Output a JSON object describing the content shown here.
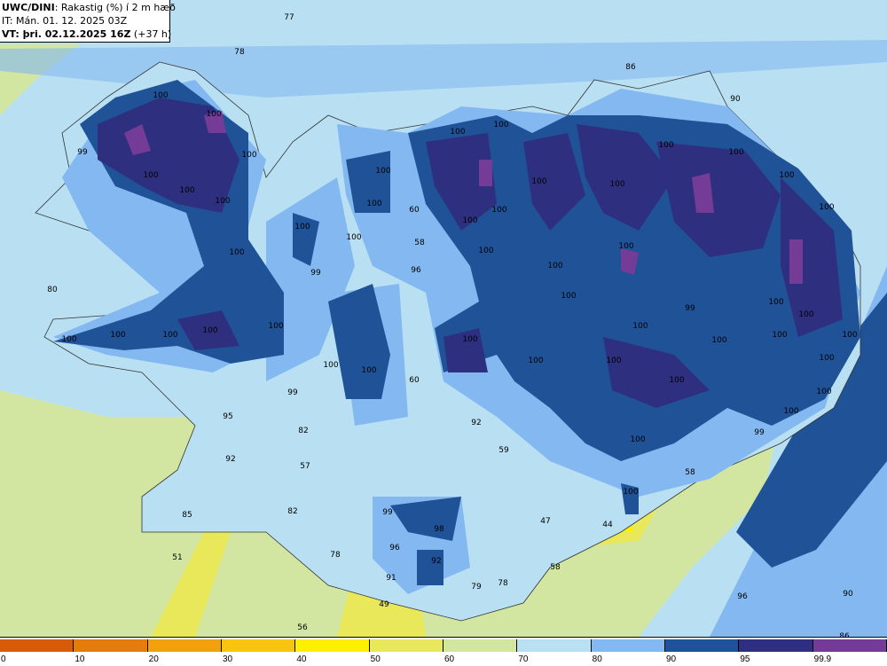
{
  "title": {
    "model": "UWC/DINI",
    "variable": ": Rakastig (%) í 2 m hæð",
    "issue_time": "IT: Mán. 01. 12. 2025 03Z",
    "valid_label": "VT: þri. 02.12.2025 16Z",
    "lead": " (+37 h)"
  },
  "legend": {
    "ticks": [
      "0",
      "10",
      "20",
      "30",
      "40",
      "50",
      "60",
      "70",
      "80",
      "90",
      "95",
      "99.9"
    ],
    "colors": [
      "#d65c0c",
      "#e27c0a",
      "#efa20a",
      "#f5c60c",
      "#fff000",
      "#e8e85a",
      "#d2e6a2",
      "#b9e0f2",
      "#84b8f0",
      "#1f5296",
      "#2f2f80",
      "#743c96"
    ]
  },
  "map_labels": [
    "77",
    "78",
    "86",
    "90",
    "100",
    "100",
    "99",
    "100",
    "100",
    "100",
    "100",
    "100",
    "100",
    "100",
    "100",
    "100",
    "100",
    "100",
    "100",
    "100",
    "60",
    "58",
    "100",
    "100",
    "100",
    "100",
    "100",
    "100",
    "100",
    "100",
    "100",
    "96",
    "99",
    "80",
    "100",
    "100",
    "100",
    "99",
    "100",
    "100",
    "100",
    "100",
    "100",
    "100",
    "100",
    "100",
    "100",
    "100",
    "100",
    "100",
    "100",
    "100",
    "100",
    "60",
    "100",
    "99",
    "100",
    "100",
    "95",
    "82",
    "92",
    "99",
    "100",
    "59",
    "92",
    "57",
    "58",
    "100",
    "85",
    "82",
    "99",
    "98",
    "47",
    "44",
    "51",
    "78",
    "96",
    "92",
    "58",
    "91",
    "79",
    "78",
    "90",
    "49",
    "96",
    "56",
    "86"
  ]
}
